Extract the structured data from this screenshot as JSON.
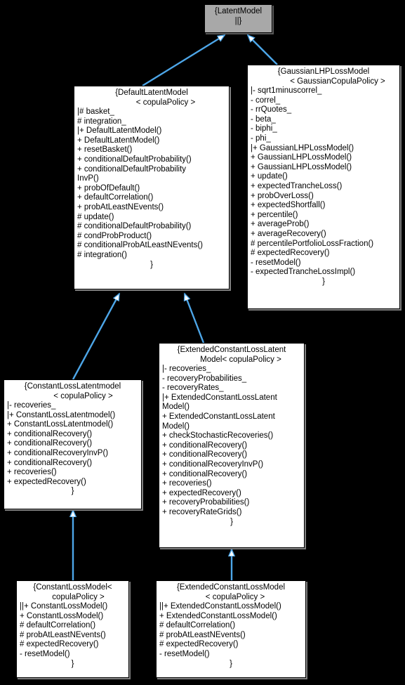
{
  "diagram": {
    "kind": "uml-class-inheritance-diagram",
    "background_color": "#000000",
    "node_fill": "#ffffff",
    "root_fill": "#a8a8a8",
    "edge_color": "#4da6e8",
    "arrow_style": "hollow-triangle-inheritance"
  },
  "nodes": {
    "latent_model": {
      "title_lines": [
        "{LatentModel",
        "||}"
      ],
      "members": [],
      "closer": ""
    },
    "default_latent_model": {
      "title_lines": [
        "{DefaultLatentModel",
        "< copulaPolicy >"
      ],
      "members": [
        "|# basket_",
        "# integration_",
        "|+ DefaultLatentModel()",
        "+ DefaultLatentModel()",
        "+ resetBasket()",
        "+ conditionalDefaultProbability()",
        "+ conditionalDefaultProbability",
        "InvP()",
        "+ probOfDefault()",
        "+ defaultCorrelation()",
        "+ probAtLeastNEvents()",
        "# update()",
        "# conditionalDefaultProbability()",
        "# condProbProduct()",
        "# conditionalProbAtLeastNEvents()",
        "# integration()"
      ],
      "closer": "}"
    },
    "gaussian_lhp_loss_model": {
      "title_lines": [
        "{GaussianLHPLossModel",
        "< GaussianCopulaPolicy >"
      ],
      "members": [
        "|- sqrt1minuscorrel_",
        "- correl_",
        "- rrQuotes_",
        "- beta_",
        "- biphi_",
        "- phi_",
        "|+ GaussianLHPLossModel()",
        "+ GaussianLHPLossModel()",
        "+ GaussianLHPLossModel()",
        "+ update()",
        "+ expectedTrancheLoss()",
        "+ probOverLoss()",
        "+ expectedShortfall()",
        "+ percentile()",
        "+ averageProb()",
        "+ averageRecovery()",
        "# percentilePortfolioLossFraction()",
        "# expectedRecovery()",
        "- resetModel()",
        "- expectedTrancheLossImpl()"
      ],
      "closer": "}"
    },
    "constant_loss_latentmodel": {
      "title_lines": [
        "{ConstantLossLatentmodel",
        "< copulaPolicy >"
      ],
      "members": [
        "|- recoveries_",
        "|+ ConstantLossLatentmodel()",
        "+ ConstantLossLatentmodel()",
        "+ conditionalRecovery()",
        "+ conditionalRecovery()",
        "+ conditionalRecoveryInvP()",
        "+ conditionalRecovery()",
        "+ recoveries()",
        "+ expectedRecovery()"
      ],
      "closer": "}"
    },
    "extended_constant_loss_latent_model": {
      "title_lines": [
        "{ExtendedConstantLossLatent",
        "Model< copulaPolicy >"
      ],
      "members": [
        "|- recoveries_",
        "- recoveryProbabilities_",
        "- recoveryRates_",
        "|+ ExtendedConstantLossLatent",
        "Model()",
        "+ ExtendedConstantLossLatent",
        "Model()",
        "+ checkStochasticRecoveries()",
        "+ conditionalRecovery()",
        "+ conditionalRecovery()",
        "+ conditionalRecoveryInvP()",
        "+ conditionalRecovery()",
        "+ recoveries()",
        "+ expectedRecovery()",
        "+ recoveryProbabilities()",
        "+ recoveryRateGrids()"
      ],
      "closer": "}"
    },
    "constant_loss_model": {
      "title_lines": [
        "{ConstantLossModel<",
        "copulaPolicy >"
      ],
      "members": [
        "||+ ConstantLossModel()",
        "+ ConstantLossModel()",
        "# defaultCorrelation()",
        "# probAtLeastNEvents()",
        "# expectedRecovery()",
        "- resetModel()"
      ],
      "closer": "}"
    },
    "extended_constant_loss_model": {
      "title_lines": [
        "{ExtendedConstantLossModel",
        "< copulaPolicy >"
      ],
      "members": [
        "||+ ExtendedConstantLossModel()",
        "+ ExtendedConstantLossModel()",
        "# defaultCorrelation()",
        "# probAtLeastNEvents()",
        "# expectedRecovery()",
        "- resetModel()"
      ],
      "closer": "}"
    }
  },
  "edges": [
    {
      "from": "default_latent_model",
      "to": "latent_model"
    },
    {
      "from": "gaussian_lhp_loss_model",
      "to": "latent_model"
    },
    {
      "from": "constant_loss_latentmodel",
      "to": "default_latent_model"
    },
    {
      "from": "extended_constant_loss_latent_model",
      "to": "default_latent_model"
    },
    {
      "from": "constant_loss_model",
      "to": "constant_loss_latentmodel"
    },
    {
      "from": "extended_constant_loss_model",
      "to": "extended_constant_loss_latent_model"
    }
  ]
}
